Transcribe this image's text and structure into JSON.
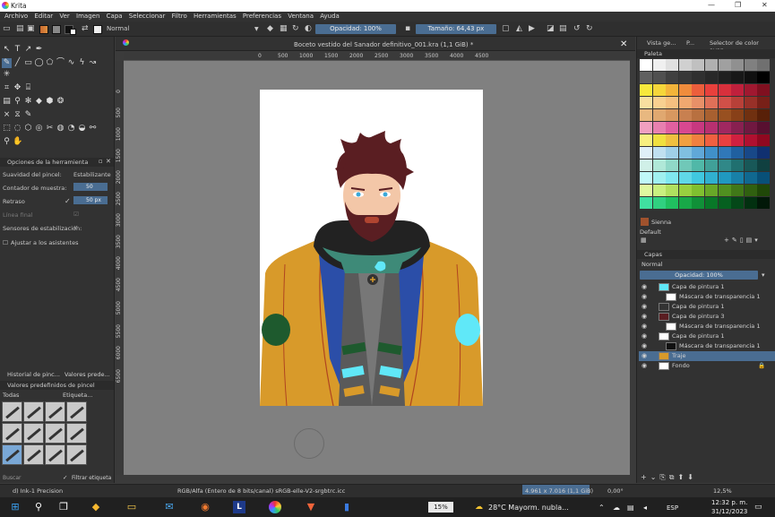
{
  "window": {
    "title": "Krita",
    "minimize": "—",
    "restore": "❐",
    "close": "✕"
  },
  "menu": [
    "Archivo",
    "Editar",
    "Ver",
    "Imagen",
    "Capa",
    "Seleccionar",
    "Filtro",
    "Herramientas",
    "Preferencias",
    "Ventana",
    "Ayuda"
  ],
  "toolbar": {
    "blend_mode": "Normal",
    "opacity_label": "Opacidad: 100%",
    "size_label": "Tamaño: 64,43 px"
  },
  "document": {
    "tab_title": "Boceto vestido del Sanador definitivo_001.kra (1,1 GiB) *",
    "close": "✕"
  },
  "ruler_h": [
    "0",
    "500",
    "1000",
    "1500",
    "2000",
    "2500",
    "3000",
    "3500",
    "4000",
    "4500"
  ],
  "ruler_v": [
    "0",
    "500",
    "1000",
    "1500",
    "2000",
    "2500",
    "3000",
    "3500",
    "4000",
    "4500",
    "5000",
    "5500",
    "6000",
    "6500"
  ],
  "tool_options": {
    "header": "Opciones de la herramienta",
    "rows": [
      {
        "label": "Suavidad del pincel:",
        "value": "Estabilizante"
      },
      {
        "label": "Contador de muestra:",
        "value": "50"
      },
      {
        "label": "Retraso",
        "value": "50 px"
      },
      {
        "label": "Línea final",
        "value": ""
      },
      {
        "label": "Sensores de estabilización:",
        "value": ""
      },
      {
        "label": "Ajustar a los asistentes",
        "value": ""
      }
    ]
  },
  "left_tabs": [
    "Historial de pinc...",
    "Valores prede..."
  ],
  "presets": {
    "header": "Valores predefinidos de pincel",
    "filter": "Todas",
    "tag": "Etiqueta...",
    "search": "Buscar",
    "filter_tag": "Filtrar etiqueta"
  },
  "right_tabs": [
    "Vista ge...",
    "P...",
    "Selector de color avan..."
  ],
  "palette": {
    "header": "Paleta",
    "selected_name": "Sienna",
    "footer": "Default",
    "colors": [
      [
        "#ffffff",
        "#f0f0f0",
        "#e0e0e0",
        "#d0d0d0",
        "#c0c0c0",
        "#b0b0b0",
        "#a0a0a0",
        "#909090",
        "#808080",
        "#707070"
      ],
      [
        "#606060",
        "#505050",
        "#404040",
        "#383838",
        "#303030",
        "#282828",
        "#202020",
        "#181818",
        "#101010",
        "#000000"
      ],
      [
        "#f7e93c",
        "#f5d63a",
        "#f3b43a",
        "#f08c3c",
        "#ec5e3c",
        "#e8403c",
        "#d8303c",
        "#c0203c",
        "#a01830",
        "#801020"
      ],
      [
        "#f8e0a0",
        "#f8d090",
        "#f5c080",
        "#f0a870",
        "#e89068",
        "#e07058",
        "#d05048",
        "#b84038",
        "#983028",
        "#782018"
      ],
      [
        "#e8b880",
        "#e0a870",
        "#d89860",
        "#c88050",
        "#b87040",
        "#a86030",
        "#985020",
        "#884018",
        "#703010",
        "#582008"
      ],
      [
        "#f0a0c0",
        "#e880b0",
        "#e060a0",
        "#d84890",
        "#c83880",
        "#b83070",
        "#a02860",
        "#882050",
        "#701840",
        "#581030"
      ],
      [
        "#f8f080",
        "#f0e040",
        "#f0c040",
        "#f0a040",
        "#f08040",
        "#f06040",
        "#e84040",
        "#d02040",
        "#b01030",
        "#900820"
      ],
      [
        "#e0f0f8",
        "#c0e0f0",
        "#a0d0e8",
        "#80c0e0",
        "#60a8d8",
        "#4090c8",
        "#3078b8",
        "#2060a0",
        "#184888",
        "#103070"
      ],
      [
        "#d0f0e8",
        "#b0e8d8",
        "#90d8c8",
        "#70c8b8",
        "#50b8a8",
        "#40a098",
        "#308888",
        "#207070",
        "#185858",
        "#104040"
      ],
      [
        "#c0f8f8",
        "#a0f0f0",
        "#80e8f0",
        "#60d8e8",
        "#40c8e0",
        "#30b0d0",
        "#2098c0",
        "#1880a8",
        "#106890",
        "#085078"
      ],
      [
        "#e0f8a0",
        "#c8f080",
        "#b0e060",
        "#98d040",
        "#80c030",
        "#68a828",
        "#509020",
        "#407818",
        "#306010",
        "#204808"
      ],
      [
        "#40e0a0",
        "#30d080",
        "#20c060",
        "#18a848",
        "#109038",
        "#087828",
        "#066020",
        "#044818",
        "#023010",
        "#011808"
      ]
    ]
  },
  "layers": {
    "header": "Capas",
    "blend": "Normal",
    "opacity": "Opacidad: 100%",
    "items": [
      {
        "name": "Capa de pintura 1",
        "indent": 1
      },
      {
        "name": "Máscara de transparencia 1",
        "indent": 2
      },
      {
        "name": "Capa de pintura 1",
        "indent": 1
      },
      {
        "name": "Capa de pintura 3",
        "indent": 1
      },
      {
        "name": "Máscara de transparencia 1",
        "indent": 2
      },
      {
        "name": "Capa de pintura 1",
        "indent": 1
      },
      {
        "name": "Máscara de transparencia 1",
        "indent": 2
      },
      {
        "name": "Traje",
        "indent": 1,
        "selected": true
      },
      {
        "name": "Fondo",
        "indent": 1
      }
    ]
  },
  "status": {
    "brush": "d) Ink-1 Precision",
    "colorspace": "RGB/Alfa (Entero de 8 bits/canal)  sRGB-elle-V2-srgbtrc.icc",
    "size": "4.961 x 7.016 (1,1 GiB)",
    "rotation": "0,00°",
    "zoom": "12,5%"
  },
  "taskbar": {
    "battery": "15%",
    "weather": "28°C  Mayorm. nubla...",
    "lang": "ESP",
    "time": "12:32 p. m.",
    "date": "31/12/2023"
  },
  "colors": {
    "accent": "#4a6d92",
    "coat": "#d89a2a",
    "vest": "#2b4ea8",
    "shirt": "#606060",
    "collar": "#2a2a2a",
    "hair": "#5a1e22",
    "skin": "#f3c7a8",
    "patch_green": "#1e5a2e",
    "patch_cyan": "#60e8f8"
  }
}
